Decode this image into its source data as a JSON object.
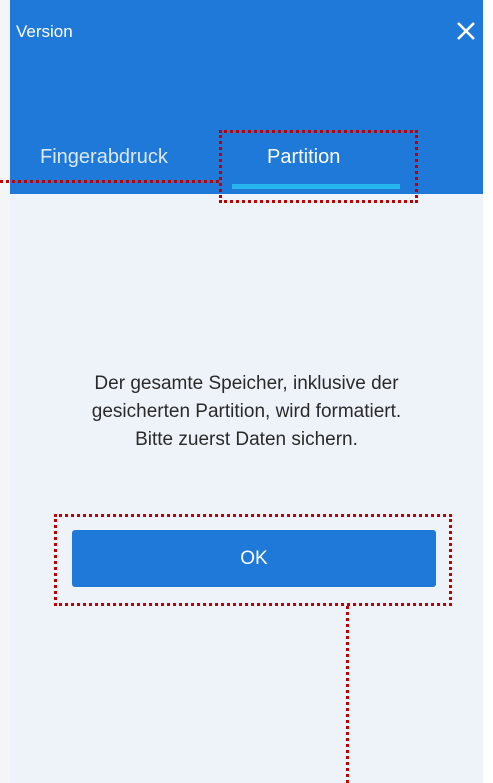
{
  "window": {
    "title": "Version",
    "close_icon": "close-icon"
  },
  "tabs": [
    {
      "label": "Fingerabdruck",
      "active": false
    },
    {
      "label": "Partition",
      "active": true
    }
  ],
  "dialog": {
    "message_lines": [
      "Der gesamte Speicher, inklusive der",
      "gesicherten Partition, wird formatiert.",
      "Bitte zuerst Daten sichern."
    ],
    "ok_label": "OK"
  },
  "colors": {
    "header_bg": "#1f79d8",
    "tab_underline": "#27b7ee",
    "body_bg": "#eef3fa",
    "button_bg": "#1f79d8",
    "annotation": "#c00000"
  }
}
